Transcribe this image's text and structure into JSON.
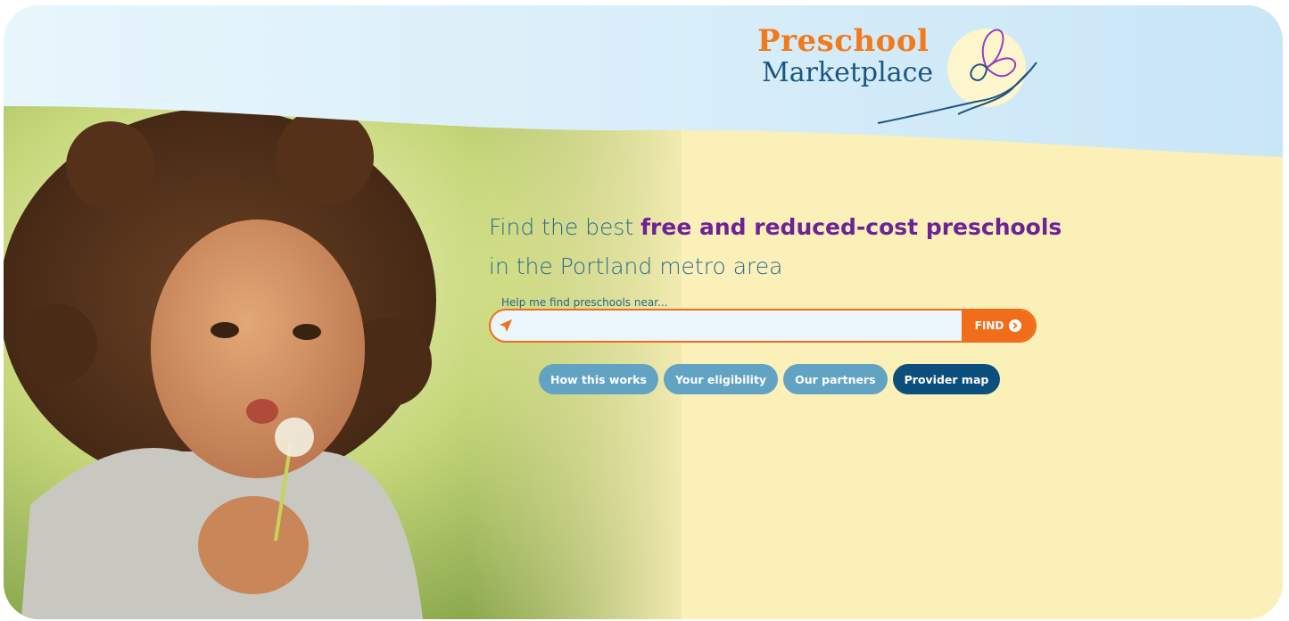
{
  "brand": {
    "line1": "Preschool",
    "line2": "Marketplace",
    "primary_color": "#f27a1d",
    "secondary_color": "#1d5580",
    "accent_purple": "#6d2396"
  },
  "hero": {
    "headline_prefix": "Find the best ",
    "headline_emphasis": "free and reduced-cost preschools",
    "headline_suffix": "in the Portland metro area",
    "photo_subject": "child-blowing-dandelion-photo"
  },
  "search": {
    "label": "Help me find preschools near...",
    "value": "",
    "placeholder": "",
    "location_icon": "location-arrow-icon",
    "button_label": "FIND",
    "button_icon": "chevron-circle-right-icon"
  },
  "nav_pills": [
    {
      "label": "How this works",
      "style": "light"
    },
    {
      "label": "Your eligibility",
      "style": "light"
    },
    {
      "label": "Our partners",
      "style": "light"
    },
    {
      "label": "Provider map",
      "style": "dark"
    }
  ]
}
